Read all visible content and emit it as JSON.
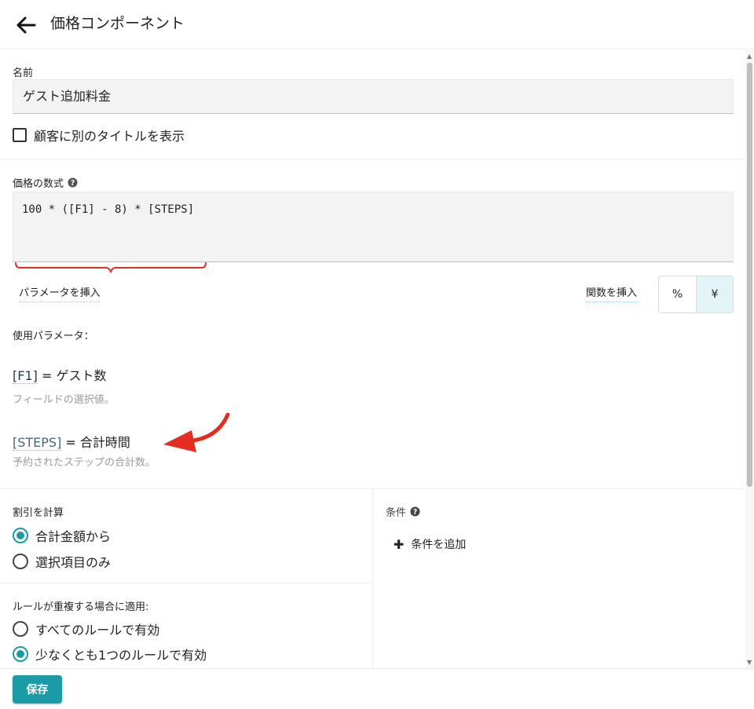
{
  "header": {
    "title": "価格コンポーネント",
    "back_icon": "arrow-left-icon"
  },
  "name_section": {
    "label": "名前",
    "value": "ゲスト追加料金",
    "show_title_checkbox": {
      "label": "顧客に別のタイトルを表示",
      "checked": false
    }
  },
  "formula": {
    "label": "価格の数式",
    "value": "100 * ([F1] - 8) * [STEPS]",
    "help_icon": "question-circle-icon",
    "insert_param": "パラメータを挿入",
    "insert_func": "関数を挿入",
    "units": [
      {
        "label": "%",
        "active": false
      },
      {
        "label": "¥",
        "active": true
      }
    ]
  },
  "params": {
    "title": "使用パラメータ：",
    "items": [
      {
        "code": "[F1]",
        "eq": " = ゲスト数",
        "desc": "フィールドの選択値。"
      },
      {
        "code": "[STEPS]",
        "eq": " = 合計時間",
        "desc": "予約されたステップの合計数。"
      }
    ]
  },
  "discount": {
    "label": "割引を計算",
    "options": [
      {
        "label": "合計金額から",
        "checked": true
      },
      {
        "label": "選択項目のみ",
        "checked": false
      }
    ]
  },
  "overlap": {
    "label": "ルールが重複する場合に適用:",
    "options": [
      {
        "label": "すべてのルールで有効",
        "checked": false
      },
      {
        "label": "少なくとも1つのルールで有効",
        "checked": true
      }
    ]
  },
  "conditions": {
    "label": "条件",
    "help_icon": "question-circle-icon",
    "add_label": "条件を追加",
    "add_icon": "plus-icon"
  },
  "footer": {
    "save_label": "保存"
  },
  "colors": {
    "accent": "#1a9ba6",
    "annotation": "#e32d22"
  }
}
